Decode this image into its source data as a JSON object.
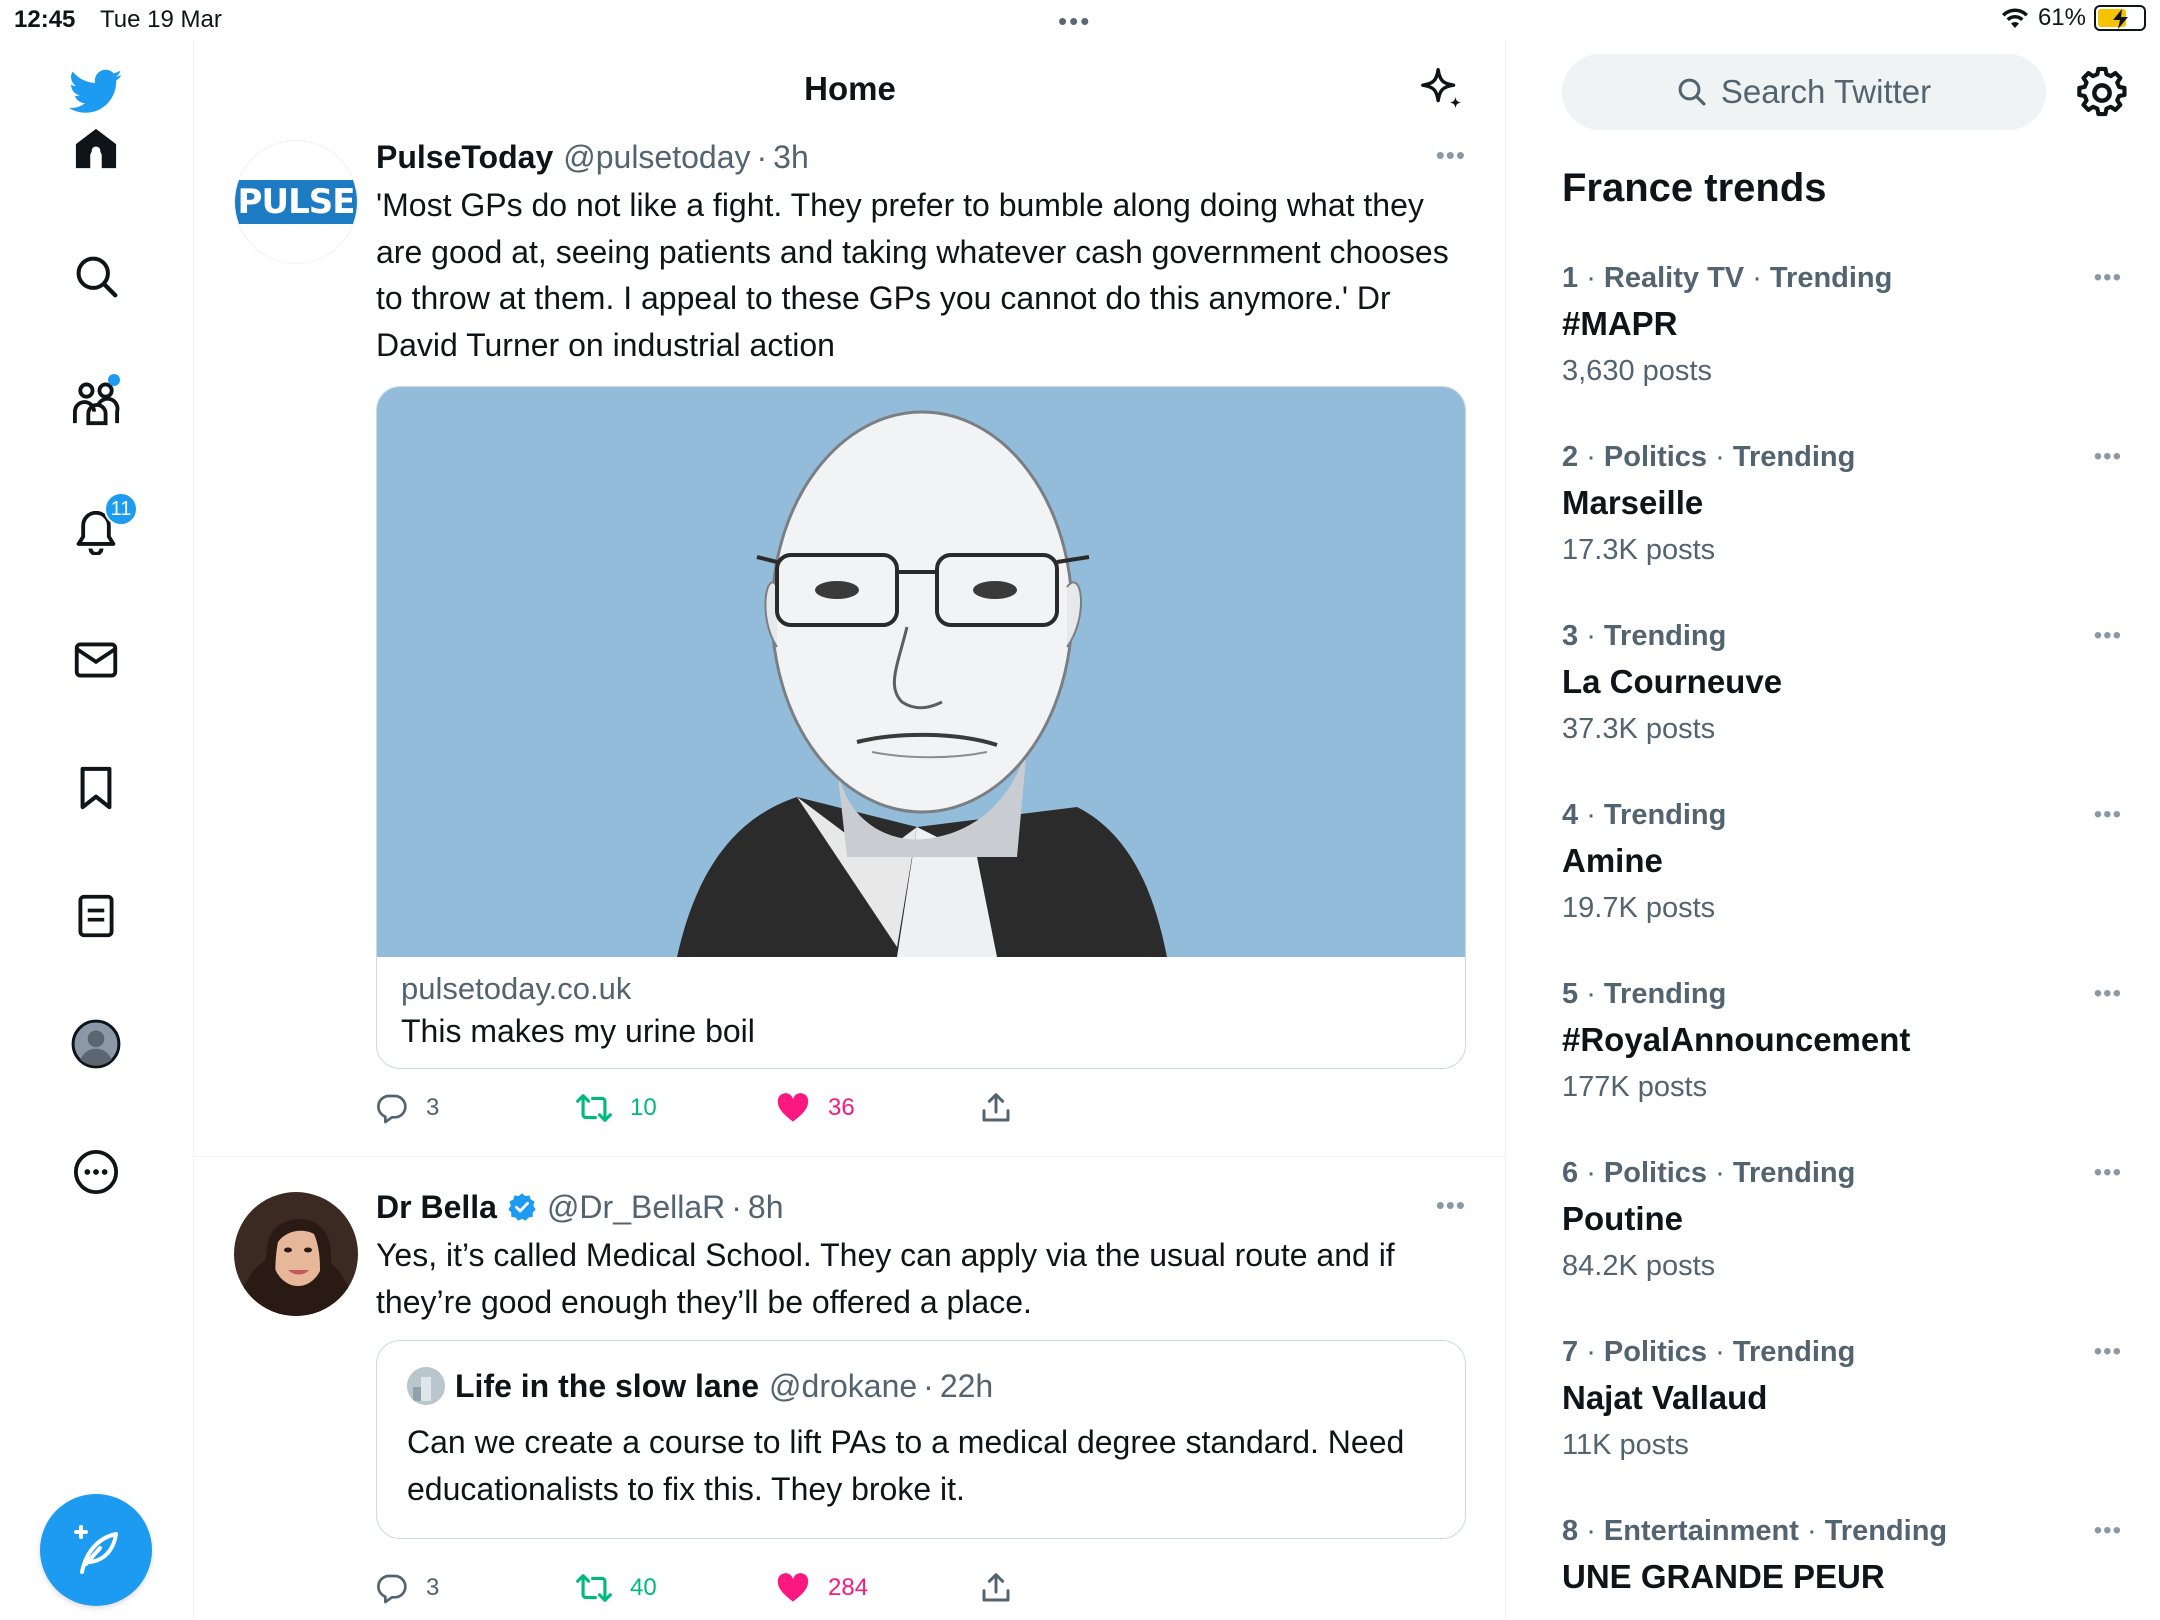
{
  "status_bar": {
    "time": "12:45",
    "date": "Tue 19 Mar",
    "battery": "61%",
    "handle_dots": "•••"
  },
  "nav": {
    "notifications_badge": "11",
    "items": [
      "home",
      "explore",
      "communities",
      "notifications",
      "messages",
      "bookmarks",
      "lists",
      "profile",
      "more"
    ]
  },
  "main": {
    "title": "Home",
    "tweets": [
      {
        "name": "PulseToday",
        "handle": "@pulsetoday",
        "sep": "·",
        "time": "3h",
        "avatar_text": "PULSE",
        "more": "•••",
        "text": "'Most GPs do not like a fight. They prefer to bumble along doing what they are good at, seeing patients and taking whatever cash government chooses to throw at them. I appeal to these GPs you cannot do this anymore.' Dr David Turner on industrial action",
        "card": {
          "domain": "pulsetoday.co.uk",
          "title": "This makes my urine boil"
        },
        "replies": "3",
        "retweets": "10",
        "likes": "36"
      },
      {
        "name": "Dr Bella",
        "handle": "@Dr_BellaR",
        "sep": "·",
        "time": "8h",
        "more": "•••",
        "text": "Yes, it’s called Medical School. They can apply via the usual route and if they’re good enough they’ll be offered a place.",
        "quote": {
          "name": "Life in the slow lane",
          "handle": "@drokane",
          "sep": "·",
          "time": "22h",
          "text": "Can we create a course to lift PAs to a medical degree standard. Need educationalists to fix this. They broke it."
        },
        "replies": "3",
        "retweets": "40",
        "likes": "284"
      }
    ]
  },
  "right": {
    "search_placeholder": "Search Twitter",
    "trends_title": "France trends",
    "trends": [
      {
        "rank": "1",
        "category": "Reality TV",
        "trending": "Trending",
        "name": "#MAPR",
        "count": "3,630 posts"
      },
      {
        "rank": "2",
        "category": "Politics",
        "trending": "Trending",
        "name": "Marseille",
        "count": "17.3K posts"
      },
      {
        "rank": "3",
        "category": "",
        "trending": "Trending",
        "name": "La Courneuve",
        "count": "37.3K posts"
      },
      {
        "rank": "4",
        "category": "",
        "trending": "Trending",
        "name": "Amine",
        "count": "19.7K posts"
      },
      {
        "rank": "5",
        "category": "",
        "trending": "Trending",
        "name": "#RoyalAnnouncement",
        "count": "177K posts"
      },
      {
        "rank": "6",
        "category": "Politics",
        "trending": "Trending",
        "name": "Poutine",
        "count": "84.2K posts"
      },
      {
        "rank": "7",
        "category": "Politics",
        "trending": "Trending",
        "name": "Najat Vallaud",
        "count": "11K posts"
      },
      {
        "rank": "8",
        "category": "Entertainment",
        "trending": "Trending",
        "name": "UNE GRANDE PEUR",
        "count": ""
      }
    ],
    "more": "•••"
  },
  "colors": {
    "accent": "#1d9bf0",
    "retweet": "#00ba7c",
    "like": "#f91880",
    "muted": "#536471"
  }
}
